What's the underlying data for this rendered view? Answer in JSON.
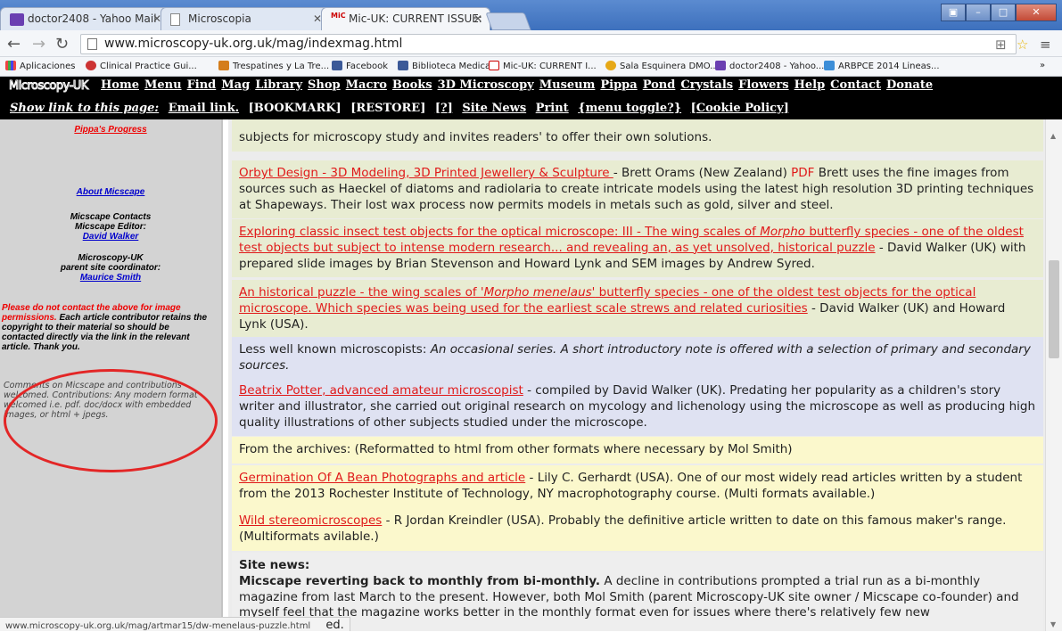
{
  "browser": {
    "tabs": [
      {
        "label": "doctor2408 - Yahoo Mail",
        "icon": "mail-icon"
      },
      {
        "label": "Microscopia",
        "icon": "page-icon"
      },
      {
        "label": "Mic-UK: CURRENT ISSUE:",
        "icon": "micuk-icon"
      }
    ],
    "url": "www.microscopy-uk.org.uk/mag/indexmag.html",
    "bookmarks": [
      "Aplicaciones",
      "Clinical Practice Gui...",
      "Trespatines y La Tre...",
      "Facebook",
      "Biblioteca Medica",
      "Mic-UK: CURRENT I...",
      "Sala Esquinera DMO...",
      "doctor2408 - Yahoo...",
      "ARBPCE 2014 Lineas..."
    ],
    "status_url": "www.microscopy-uk.org.uk/mag/artmar15/dw-menelaus-puzzle.html"
  },
  "site": {
    "logo": "Microscopy-UK",
    "nav": [
      "Home",
      "Menu",
      "Find",
      "Mag",
      "Library",
      "Shop",
      "Macro",
      "Books",
      "3D Microscopy",
      "Museum",
      "Pippa",
      "Pond",
      "Crystals",
      "Flowers",
      "Help",
      "Contact",
      "Donate"
    ],
    "nav2": {
      "show_link": "Show link to this page:",
      "email": "Email link.",
      "bookmark": "[BOOKMARK]",
      "restore": "[RESTORE]",
      "help": "[?]",
      "site_news": "Site News",
      "print": "Print",
      "menu_toggle": "{menu toggle?}",
      "cookie": "[Cookie Policy]"
    }
  },
  "sidebar": {
    "top_link": "Pippa's Progress",
    "about": "About Micscape",
    "contacts": "Micscape Contacts",
    "editor_label": "Micscape Editor:",
    "editor": "David Walker",
    "coordinator_label1": "Microscopy-UK",
    "coordinator_label2": "parent site coordinator:",
    "coordinator": "Maurice Smith",
    "notice_red": "Please do not contact the above for image permissions.",
    "notice_black": "Each article contributor retains the copyright to their material so should be contacted directly via the link in the relevant article. Thank you.",
    "comments": "Comments on Micscape and contributions welcomed. Contributions: Any modern format welcomed i.e. pdf. doc/docx with embedded images, or html + jpegs."
  },
  "entries": {
    "e0": {
      "rest": "subjects for microscopy study and invites readers' to offer their own solutions."
    },
    "e1": {
      "link": "Orbyt Design - 3D Modeling, 3D Printed Jewellery & Sculpture ",
      "pre": "- Brett Orams (New Zealand) ",
      "pdf": "PDF",
      "rest": " Brett uses the fine images from sources such as Haeckel of diatoms and radiolaria to create intricate models using the latest high resolution 3D printing techniques at Shapeways. Their lost wax process now permits models in metals such as gold, silver and steel."
    },
    "e2": {
      "link_a": "Exploring classic insect test objects for the optical microscope: III - The wing scales of ",
      "link_i": "Morpho",
      "link_b": " butterfly species - one of the oldest test objects but subject to intense modern research... and revealing an, as yet unsolved, historical puzzle",
      "rest": " - David Walker (UK) with prepared slide images by Brian Stevenson and Howard Lynk and SEM images by Andrew Syred."
    },
    "e3": {
      "link_a": "An historical puzzle - the wing scales of ",
      "link_i": "'Morpho menelaus'",
      "link_b": " butterfly species - one of the oldest test objects for the optical microscope. Which species was being used for the earliest scale strews and related curiosities",
      "rest": " - David Walker (UK) and Howard Lynk (USA)."
    },
    "e4": {
      "pre": "Less well known microscopists: ",
      "italic": "An occasional series. A short introductory note is offered with a selection of primary and secondary sources."
    },
    "e5": {
      "link": "Beatrix Potter, advanced amateur microscopist",
      "rest": " - compiled by David Walker (UK). Predating her popularity as a children's story writer and illustrator, she carried out original research on mycology and lichenology using the microscope as well as producing high quality illustrations of other subjects studied under the microscope."
    },
    "e6": {
      "text": "From the archives: (Reformatted to html from other formats where necessary by Mol Smith)"
    },
    "e7": {
      "link": "Germination Of A Bean Photographs and article",
      "rest": " - Lily C. Gerhardt (USA). One of our most widely read articles written by a student from the 2013 Rochester Institute of Technology, NY macrophotography course. (Multi formats available.)"
    },
    "e8": {
      "link": "Wild stereomicroscopes",
      "rest": " - R Jordan Kreindler (USA). Probably the definitive article written to date on this famous maker's range. (Multiformats avilable.)"
    },
    "news": {
      "heading": "Site news:",
      "bold": "Micscape reverting back to monthly from bi-monthly.",
      "rest": " A decline in contributions prompted a trial run as a bi-monthly magazine from last March to the present. However, both Mol Smith (parent Microscopy-UK site owner / Micscape co-founder) and myself feel that the magazine works better in the monthly format even for issues where there's relatively few new",
      "tail": "ed."
    }
  }
}
